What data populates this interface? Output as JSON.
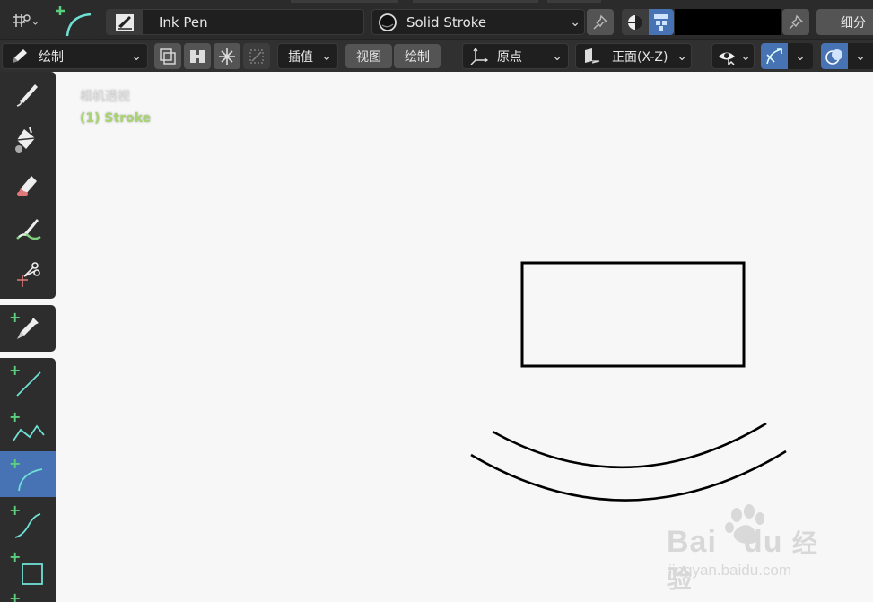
{
  "header": {
    "brush_name": "Ink Pen",
    "material_name": "Solid Stroke",
    "subdivide_label": "细分",
    "color_swatch": "#000000"
  },
  "toolbar_row": {
    "mode_label": "绘制",
    "interpolate_label": "插值",
    "view_label": "视图",
    "draw_label": "绘制",
    "origin_label": "原点",
    "plane_label": "正面(X-Z)"
  },
  "viewport": {
    "view_name": "相机透视",
    "object_name": "(1) Stroke"
  },
  "tools": [
    {
      "name": "draw"
    },
    {
      "name": "fill"
    },
    {
      "name": "erase"
    },
    {
      "name": "tint"
    },
    {
      "name": "cutter"
    },
    {
      "name": "eyedropper"
    },
    {
      "name": "line"
    },
    {
      "name": "polyline"
    },
    {
      "name": "arc"
    },
    {
      "name": "curve"
    },
    {
      "name": "box"
    }
  ],
  "watermark": {
    "brand": "Bai",
    "brand2": "du",
    "cn": "经验",
    "url": "jingyan.baidu.com"
  },
  "colors": {
    "accent": "#4772b3",
    "plus": "#5bd07c",
    "object_name": "#a8d46f"
  }
}
